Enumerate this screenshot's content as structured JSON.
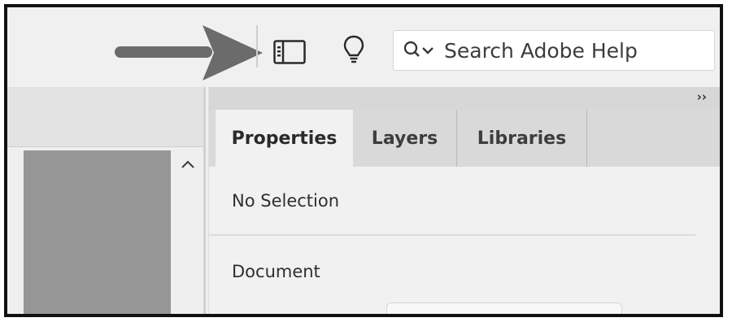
{
  "toolbar": {
    "annotation_arrow_icon": "right-arrow-icon",
    "panel_toggle_icon": "panel-layout-icon",
    "tips_icon": "lightbulb-icon",
    "search": {
      "icon": "search-dropdown-icon",
      "placeholder": "Search Adobe Help",
      "value": ""
    }
  },
  "panel": {
    "collapse_label": "››",
    "tabs": [
      {
        "label": "Properties",
        "active": true
      },
      {
        "label": "Layers",
        "active": false
      },
      {
        "label": "Libraries",
        "active": false
      }
    ],
    "selection_status": "No Selection",
    "section_document": "Document"
  },
  "colors": {
    "arrow": "#6b6b6b",
    "canvas_gray": "#969696",
    "tab_active": "#f1f1f1",
    "tab_inactive": "#d9d9d9"
  }
}
